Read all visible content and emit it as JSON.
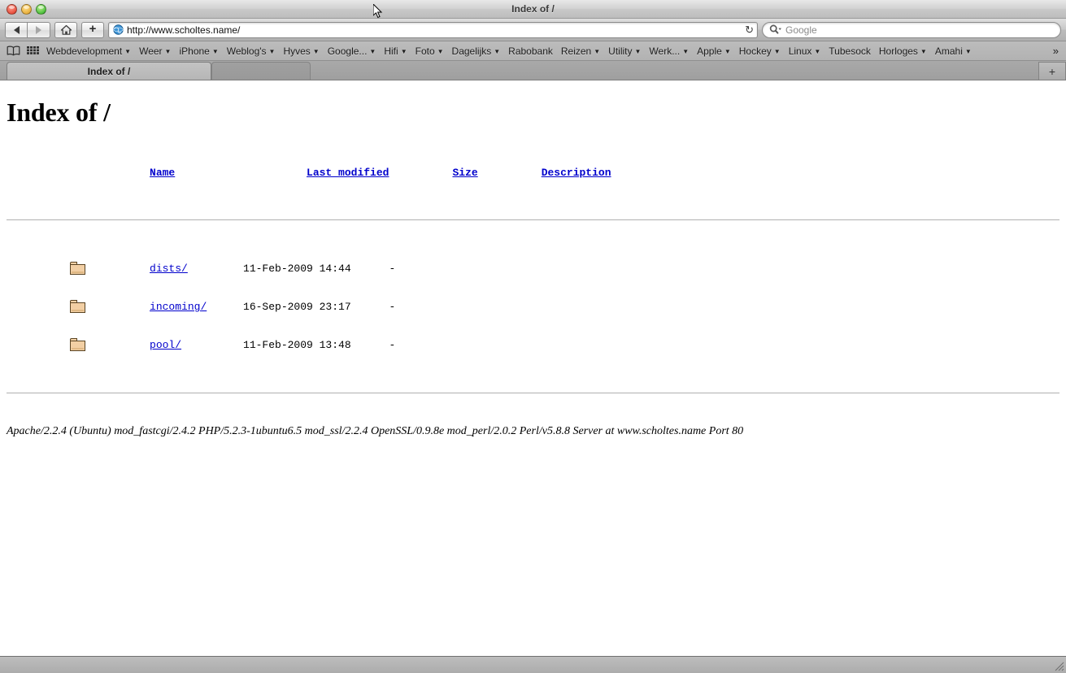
{
  "window": {
    "title": "Index of /",
    "traffic_lights": [
      "close",
      "minimize",
      "zoom"
    ]
  },
  "toolbar": {
    "back_label": "◀",
    "forward_label": "▶",
    "home_label": "home-icon",
    "add_bookmark_label": "+",
    "url": "http://www.scholtes.name/",
    "reload_label": "↻",
    "search_placeholder": "Google"
  },
  "bookmarks": {
    "show_all_icon": "book-icon",
    "top_sites_icon": "grid-icon",
    "overflow_label": "»",
    "items": [
      {
        "label": "Webdevelopment",
        "has_menu": true
      },
      {
        "label": "Weer",
        "has_menu": true
      },
      {
        "label": "iPhone",
        "has_menu": true
      },
      {
        "label": "Weblog's",
        "has_menu": true
      },
      {
        "label": "Hyves",
        "has_menu": true
      },
      {
        "label": "Google...",
        "has_menu": true
      },
      {
        "label": "Hifi",
        "has_menu": true
      },
      {
        "label": "Foto",
        "has_menu": true
      },
      {
        "label": "Dagelijks",
        "has_menu": true
      },
      {
        "label": "Rabobank",
        "has_menu": false
      },
      {
        "label": "Reizen",
        "has_menu": true
      },
      {
        "label": "Utility",
        "has_menu": true
      },
      {
        "label": "Werk...",
        "has_menu": true
      },
      {
        "label": "Apple",
        "has_menu": true
      },
      {
        "label": "Hockey",
        "has_menu": true
      },
      {
        "label": "Linux",
        "has_menu": true
      },
      {
        "label": "Tubesock",
        "has_menu": false
      },
      {
        "label": "Horloges",
        "has_menu": true
      },
      {
        "label": "Amahi",
        "has_menu": true
      }
    ]
  },
  "tabs": {
    "active_label": "Index of /",
    "new_tab_label": "+"
  },
  "page": {
    "heading": "Index of /",
    "columns": {
      "name": "Name",
      "last_modified": "Last modified",
      "size": "Size",
      "description": "Description"
    },
    "rows": [
      {
        "icon": "folder-icon",
        "name": "dists/",
        "last_modified": "11-Feb-2009 14:44",
        "size": "-",
        "description": ""
      },
      {
        "icon": "folder-icon",
        "name": "incoming/",
        "last_modified": "16-Sep-2009 23:17",
        "size": "-",
        "description": ""
      },
      {
        "icon": "folder-icon",
        "name": "pool/",
        "last_modified": "11-Feb-2009 13:48",
        "size": "-",
        "description": ""
      }
    ],
    "signature": "Apache/2.2.4 (Ubuntu) mod_fastcgi/2.4.2 PHP/5.2.3-1ubuntu6.5 mod_ssl/2.2.4 OpenSSL/0.9.8e mod_perl/2.0.2 Perl/v5.8.8 Server at www.scholtes.name Port 80"
  },
  "colors": {
    "link": "#0000cc",
    "chrome": "#b4b4b4",
    "page_bg": "#ffffff",
    "folder": "#f2cfa4"
  }
}
